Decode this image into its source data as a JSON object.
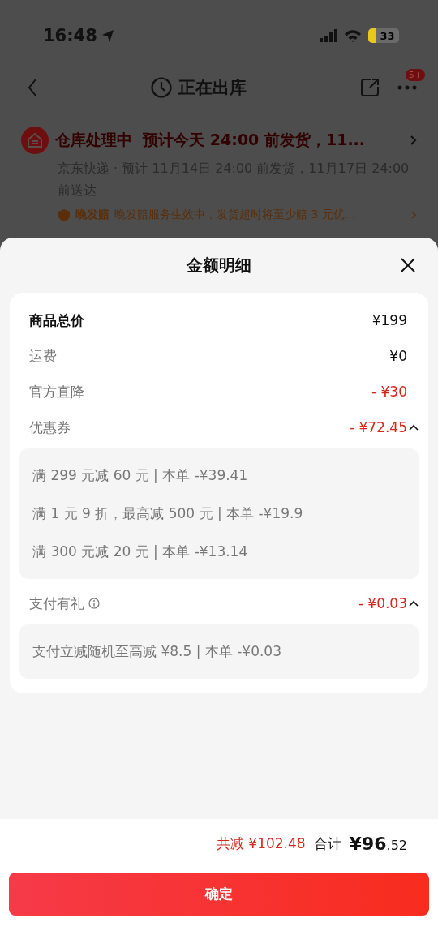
{
  "status_bar": {
    "time": "16:48",
    "battery": "33"
  },
  "nav": {
    "title": "正在出库",
    "badge": "5+"
  },
  "order_card": {
    "headline": "仓库处理中  预计今天 24:00 前发货，11...",
    "detail": "京东快递 · 预计 11月14日 24:00 前发货，11月17日 24:00 前送达",
    "guarantee_label": "晚发赔",
    "guarantee_text": "晚发赔服务生效中，发货超时将至少赔 3 元优..."
  },
  "sheet": {
    "title": "金额明细",
    "rows": [
      {
        "kind": "total",
        "label": "商品总价",
        "value": "¥199"
      },
      {
        "kind": "fee",
        "label": "运费",
        "value": "¥0"
      },
      {
        "kind": "discount",
        "label": "官方直降",
        "value": "- ¥30"
      },
      {
        "kind": "discount",
        "label": "优惠券",
        "value": "- ¥72.45",
        "expanded": true,
        "details": [
          "满 299 元减 60 元 | 本单 -¥39.41",
          "满 1 元 9 折，最高减 500 元 | 本单 -¥19.9",
          "满 300 元减 20 元 | 本单 -¥13.14"
        ]
      },
      {
        "kind": "discount",
        "label": "支付有礼",
        "info": true,
        "value": "- ¥0.03",
        "expanded": true,
        "details": [
          "支付立减随机至高减 ¥8.5 | 本单 -¥0.03"
        ]
      }
    ]
  },
  "footer": {
    "saved": "共减 ¥102.48",
    "total_label": "合计",
    "total_main": "¥96",
    "total_cents": ".52",
    "confirm": "确定"
  }
}
